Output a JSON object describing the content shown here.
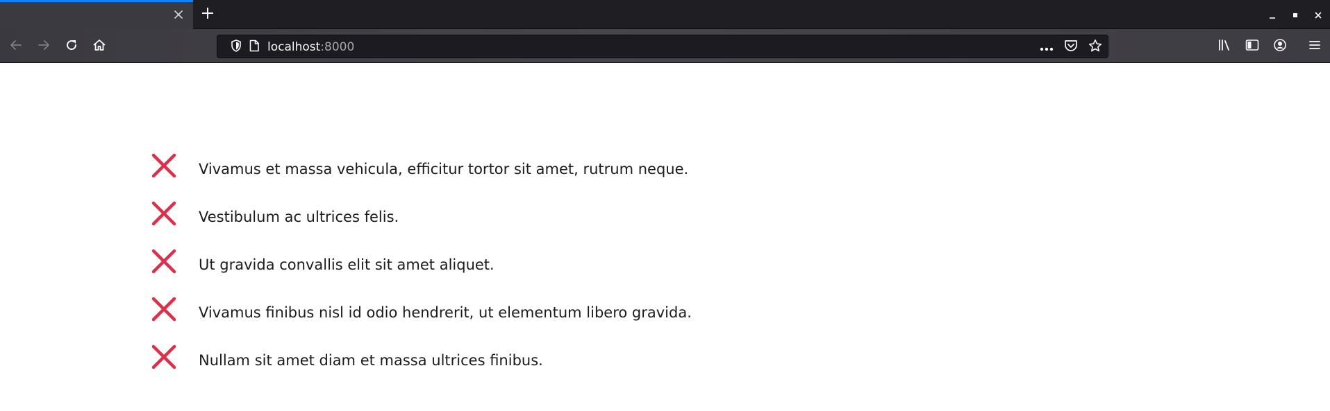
{
  "browser": {
    "tab": {
      "title": "",
      "close_icon": "close-icon"
    },
    "new_tab_icon": "plus-icon",
    "window_controls": [
      "minimize-icon",
      "maximize-icon",
      "close-icon"
    ],
    "nav_icons": [
      "back-arrow-icon",
      "forward-arrow-icon",
      "reload-icon",
      "home-icon"
    ],
    "url": {
      "host": "localhost",
      "port": ":8000"
    },
    "url_icons": [
      "shield-icon",
      "page-icon",
      "more-dots-icon",
      "pocket-icon",
      "star-icon"
    ],
    "toolbar_icons": [
      "library-icon",
      "sidebar-icon",
      "account-icon",
      "hamburger-menu-icon"
    ],
    "colors": {
      "accent": "#0a84ff",
      "tab_bar": "#1f1e23",
      "toolbar": "#46454b",
      "urlbar": "#1c1b22"
    }
  },
  "page": {
    "icon": "cross-icon",
    "icon_color": "#dc2f4a",
    "items": [
      {
        "text": "Vivamus et massa vehicula, efficitur tortor sit amet, rutrum neque."
      },
      {
        "text": "Vestibulum ac ultrices felis."
      },
      {
        "text": "Ut gravida convallis elit sit amet aliquet."
      },
      {
        "text": "Vivamus finibus nisl id odio hendrerit, ut elementum libero gravida."
      },
      {
        "text": "Nullam sit amet diam et massa ultrices finibus."
      }
    ]
  }
}
